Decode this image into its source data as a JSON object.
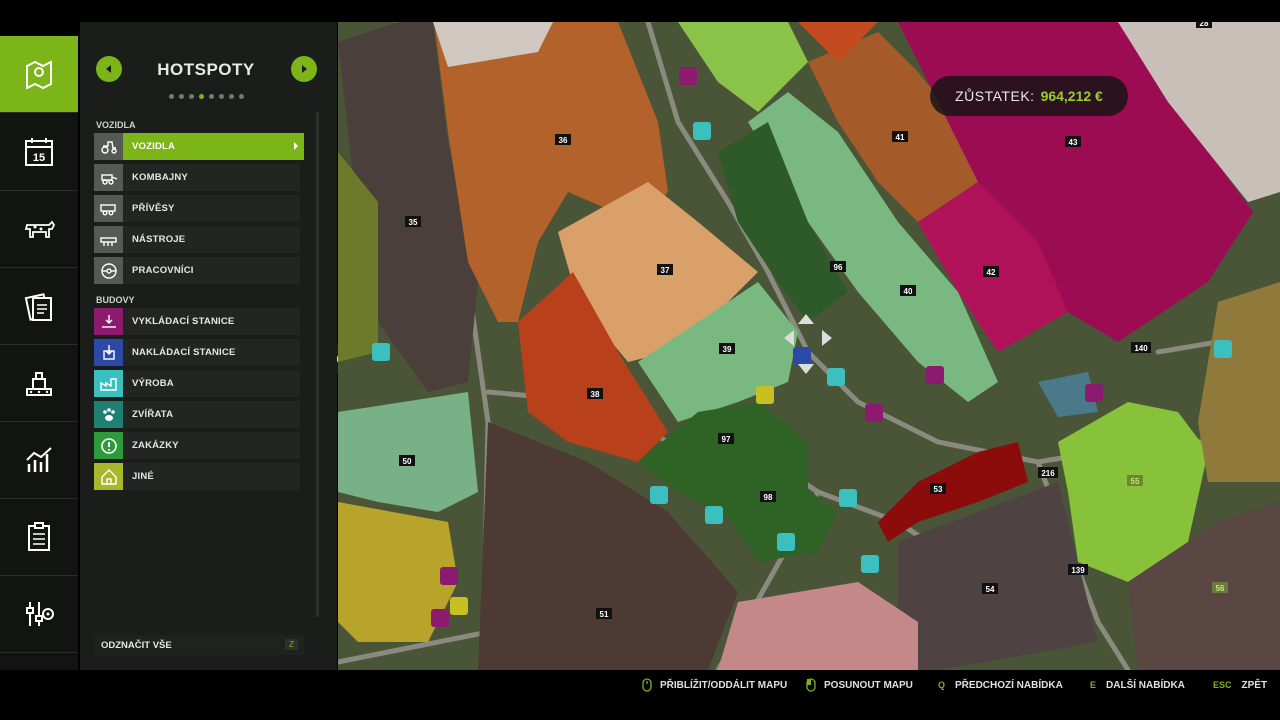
{
  "sidebar": {
    "items": [
      {
        "icon": "map-icon",
        "active": true
      },
      {
        "icon": "calendar-icon",
        "value": "15",
        "active": false
      },
      {
        "icon": "cow-icon",
        "active": false
      },
      {
        "icon": "contracts-icon",
        "active": false
      },
      {
        "icon": "production-icon",
        "active": false
      },
      {
        "icon": "statistics-icon",
        "active": false
      },
      {
        "icon": "checklist-icon",
        "active": false
      },
      {
        "icon": "settings-icon",
        "active": false
      }
    ]
  },
  "panel": {
    "title": "HOTSPOTY",
    "page_count": 8,
    "active_page": 4,
    "sections": [
      {
        "label": "VOZIDLA",
        "items": [
          {
            "label": "VOZIDLA",
            "icon": "tractor-icon",
            "color": "#555a55",
            "active": true
          },
          {
            "label": "KOMBAJNY",
            "icon": "combine-icon",
            "color": "#555a55",
            "active": false
          },
          {
            "label": "PŘÍVĚSY",
            "icon": "trailer-icon",
            "color": "#555a55",
            "active": false
          },
          {
            "label": "NÁSTROJE",
            "icon": "tools-icon",
            "color": "#555a55",
            "active": false
          },
          {
            "label": "PRACOVNÍCI",
            "icon": "steering-wheel-icon",
            "color": "#555a55",
            "active": false
          }
        ]
      },
      {
        "label": "BUDOVY",
        "items": [
          {
            "label": "VYKLÁDACÍ STANICE",
            "icon": "unload-icon",
            "color": "#8c1a6e",
            "active": false
          },
          {
            "label": "NAKLÁDACÍ STANICE",
            "icon": "load-icon",
            "color": "#2b4aa8",
            "active": false
          },
          {
            "label": "VÝROBA",
            "icon": "factory-icon",
            "color": "#3bbfbf",
            "active": false
          },
          {
            "label": "ZVÍŘATA",
            "icon": "paw-icon",
            "color": "#1e8070",
            "active": false
          },
          {
            "label": "ZAKÁZKY",
            "icon": "exclamation-icon",
            "color": "#2d9a3c",
            "active": false
          },
          {
            "label": "JINÉ",
            "icon": "house-icon",
            "color": "#a8b82a",
            "active": false
          }
        ]
      }
    ],
    "deselect_label": "ODZNAČIT VŠE",
    "deselect_key": "Z"
  },
  "balance": {
    "label": "ZŮSTATEK:",
    "value": "964,212 €"
  },
  "map": {
    "fields": [
      {
        "id": "35",
        "color": "#4a3f3a"
      },
      {
        "id": "36",
        "color": "#b3622b"
      },
      {
        "id": "37",
        "color": "#d9a06a"
      },
      {
        "id": "38",
        "color": "#b8401a"
      },
      {
        "id": "39",
        "color": "#7ab881"
      },
      {
        "id": "40",
        "color": "#7ab881"
      },
      {
        "id": "41",
        "color": "#a55a2a"
      },
      {
        "id": "42",
        "color": "#b0125a"
      },
      {
        "id": "43",
        "color": "#9b0c52"
      },
      {
        "id": "50",
        "color": "#79b186"
      },
      {
        "id": "51",
        "color": "#4e3a35"
      },
      {
        "id": "53",
        "color": "#8c0c0c"
      },
      {
        "id": "54",
        "color": "#4e4242"
      },
      {
        "id": "55",
        "color": "#88c23a"
      },
      {
        "id": "56",
        "color": "#5a4642"
      },
      {
        "id": "96",
        "color": "#2e5a2a"
      },
      {
        "id": "97",
        "color": "#2f6326"
      },
      {
        "id": "98",
        "color": "#2f6326"
      },
      {
        "id": "139",
        "color": "#4a4a40"
      },
      {
        "id": "140",
        "color": "#4a4a40"
      },
      {
        "id": "216",
        "color": "#4a4a40"
      },
      {
        "id": "28",
        "color": "#c8c0b8"
      }
    ]
  },
  "hints": [
    {
      "key_icon": "mouse-wheel-icon",
      "label": "PŘIBLÍŽIT/ODDÁLIT MAPU"
    },
    {
      "key_icon": "mouse-drag-icon",
      "label": "POSUNOUT MAPU"
    },
    {
      "key": "Q",
      "label": "PŘEDCHOZÍ NABÍDKA"
    },
    {
      "key": "E",
      "label": "DALŠÍ NABÍDKA"
    },
    {
      "key": "ESC",
      "label": "ZPĚT"
    }
  ]
}
